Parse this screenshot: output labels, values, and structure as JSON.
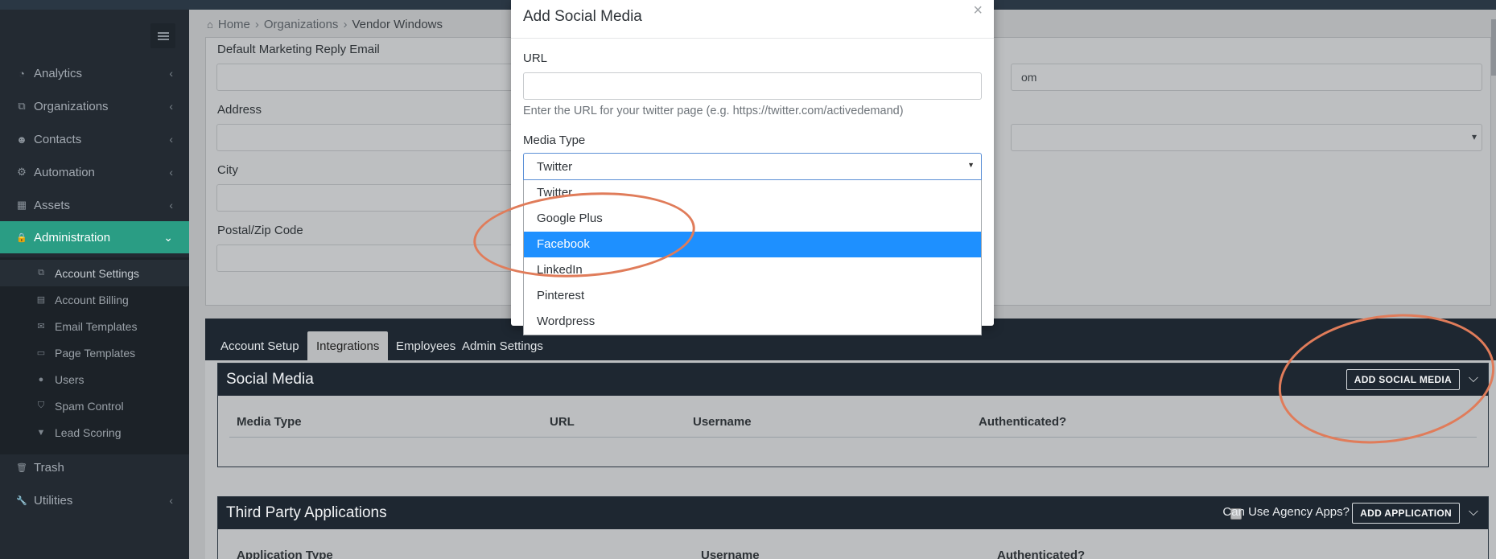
{
  "sidebar": {
    "toggle_icon": "hamburger-icon",
    "items": [
      {
        "label": "Analytics",
        "icon": "dashboard-icon",
        "glyph": "◔",
        "chevron": "‹"
      },
      {
        "label": "Organizations",
        "icon": "sitemap-icon",
        "glyph": "⧉",
        "chevron": "‹"
      },
      {
        "label": "Contacts",
        "icon": "users-icon",
        "glyph": "☻",
        "chevron": "‹"
      },
      {
        "label": "Automation",
        "icon": "cogs-icon",
        "glyph": "⚙",
        "chevron": "‹"
      },
      {
        "label": "Assets",
        "icon": "grid-icon",
        "glyph": "▦",
        "chevron": "‹"
      },
      {
        "label": "Administration",
        "icon": "lock-icon",
        "glyph": "🔒",
        "chevron": "⌄"
      },
      {
        "label": "Trash",
        "icon": "trash-icon",
        "glyph": "🗑",
        "chevron": ""
      },
      {
        "label": "Utilities",
        "icon": "wrench-icon",
        "glyph": "🔧",
        "chevron": "‹"
      }
    ],
    "sub_items": [
      {
        "label": "Account Settings",
        "icon": "sitemap-icon",
        "glyph": "⧉"
      },
      {
        "label": "Account Billing",
        "icon": "file-icon",
        "glyph": "▤"
      },
      {
        "label": "Email Templates",
        "icon": "envelope-icon",
        "glyph": "✉"
      },
      {
        "label": "Page Templates",
        "icon": "layout-icon",
        "glyph": "▭"
      },
      {
        "label": "Users",
        "icon": "user-icon",
        "glyph": "●"
      },
      {
        "label": "Spam Control",
        "icon": "shield-icon",
        "glyph": "⛉"
      },
      {
        "label": "Lead Scoring",
        "icon": "filter-icon",
        "glyph": "▼"
      }
    ]
  },
  "breadcrumb": {
    "home_icon": "home-icon",
    "home": "Home",
    "organizations": "Organizations",
    "current": "Vendor Windows",
    "separator": "›"
  },
  "form": {
    "reply_email_label": "Default Marketing Reply Email",
    "address_label": "Address",
    "city_label": "City",
    "postal_label": "Postal/Zip Code",
    "right_field_value_partial": "om",
    "right_select_arrow": "▾"
  },
  "tabs": [
    "Account Setup",
    "Integrations",
    "Employees",
    "Admin Settings"
  ],
  "social_media_card": {
    "title": "Social Media",
    "add_button": "ADD SOCIAL MEDIA",
    "chevron": "⌵",
    "columns": [
      "Media Type",
      "URL",
      "Username",
      "Authenticated?"
    ]
  },
  "third_party_card": {
    "title": "Third Party Applications",
    "agency_label": "Can Use Agency Apps?",
    "add_button": "ADD APPLICATION",
    "chevron": "⌵",
    "columns": [
      "Application Type",
      "Username",
      "Authenticated?"
    ]
  },
  "modal": {
    "title": "Add Social Media",
    "close": "×",
    "url_label": "URL",
    "url_value": "",
    "url_help": "Enter the URL for your twitter page (e.g. https://twitter.com/activedemand)",
    "media_type_label": "Media Type",
    "media_type_selected": "Twitter",
    "select_arrow": "▼",
    "options": [
      "Twitter",
      "Google Plus",
      "Facebook",
      "LinkedIn",
      "Pinterest",
      "Wordpress"
    ],
    "highlighted_option": "Facebook"
  },
  "colors": {
    "accent": "#2a9d84",
    "sidebar_bg": "#232a32",
    "header_bg": "#1e2731",
    "highlight": "#1e90ff",
    "annotation": "#e07c5a"
  }
}
